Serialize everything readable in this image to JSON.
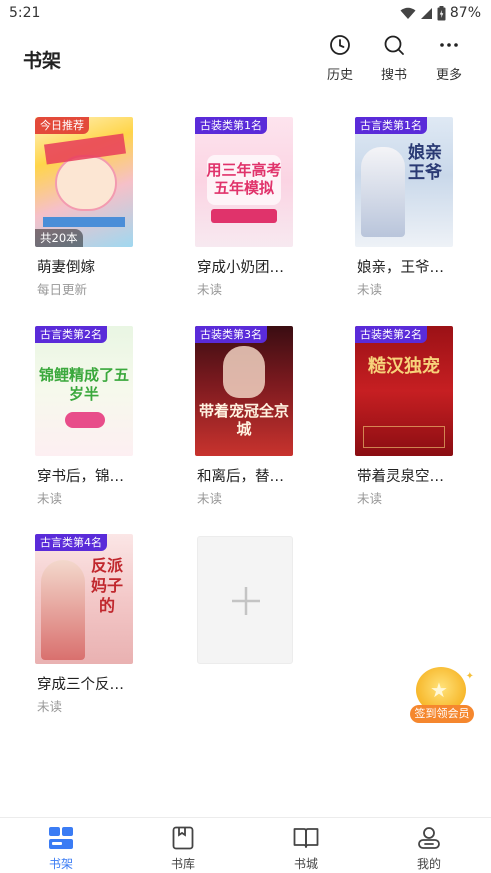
{
  "status_bar": {
    "time": "5:21",
    "battery": "87%"
  },
  "header": {
    "title": "书架",
    "actions": [
      {
        "label": "历史",
        "icon": "clock-icon"
      },
      {
        "label": "搜书",
        "icon": "search-icon"
      },
      {
        "label": "更多",
        "icon": "more-icon"
      }
    ]
  },
  "books": [
    {
      "title": "萌妻倒嫁",
      "sub": "每日更新",
      "tag": "今日推荐",
      "count": "共20本"
    },
    {
      "title": "穿成小奶团…",
      "sub": "未读",
      "tag": "古装类第1名",
      "cover_text": "用三年高考五年模拟"
    },
    {
      "title": "娘亲，王爷…",
      "sub": "未读",
      "tag": "古言类第1名",
      "cover_text": "娘亲王爷"
    },
    {
      "title": "穿书后，锦…",
      "sub": "未读",
      "tag": "古言类第2名",
      "cover_text": "锦鲤精成了五岁半"
    },
    {
      "title": "和离后，替…",
      "sub": "未读",
      "tag": "古装类第3名",
      "cover_text": "带着宠冠全京城"
    },
    {
      "title": "带着灵泉空…",
      "sub": "未读",
      "tag": "古装类第2名",
      "cover_text": "糙汉独宠"
    },
    {
      "title": "穿成三个反…",
      "sub": "未读",
      "tag": "古言类第4名",
      "cover_text": "反派妈子的"
    }
  ],
  "vip_badge": {
    "label": "签到领会员"
  },
  "tabbar": [
    {
      "label": "书架",
      "icon": "bookshelf-icon",
      "active": true
    },
    {
      "label": "书库",
      "icon": "book-icon",
      "active": false
    },
    {
      "label": "书城",
      "icon": "open-book-icon",
      "active": false
    },
    {
      "label": "我的",
      "icon": "profile-icon",
      "active": false
    }
  ],
  "colors": {
    "accent": "#3b7cf4",
    "tag_purple": "#5a2bd9",
    "tag_red": "#e34a3a",
    "vip_orange": "#f5872e"
  }
}
